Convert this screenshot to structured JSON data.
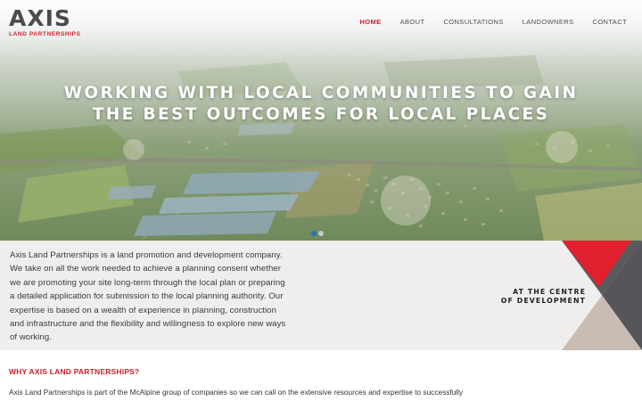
{
  "brand": {
    "name": "AXIS",
    "tagline": "LAND PARTNERSHIPS"
  },
  "nav": {
    "items": [
      {
        "label": "HOME",
        "active": true
      },
      {
        "label": "ABOUT",
        "active": false
      },
      {
        "label": "CONSULTATIONS",
        "active": false
      },
      {
        "label": "LANDOWNERS",
        "active": false
      },
      {
        "label": "CONTACT",
        "active": false
      }
    ]
  },
  "hero": {
    "line1": "WORKING WITH LOCAL COMMUNITIES TO GAIN",
    "line2": "THE BEST OUTCOMES FOR LOCAL PLACES",
    "slide_count": 2,
    "active_slide": 1
  },
  "intro": {
    "text": "Axis Land Partnerships is a land promotion and development company. We take on all the work needed to achieve a planning consent whether we are promoting your site long-term through the local plan or preparing a detailed application for submission to the local planning authority. Our expertise is based on a wealth of experience in planning, construction and infrastructure and the flexibility and willingness to explore new ways of working.",
    "tagline_line1": "AT THE CENTRE",
    "tagline_line2": "OF DEVELOPMENT"
  },
  "why": {
    "heading": "WHY AXIS LAND PARTNERSHIPS?",
    "body": "Axis Land Partnerships is part of the McAlpine group of companies so we can call on the extensive resources and expertise to successfully negotiate your projects through the planning process from the vast construction and civil engineering"
  },
  "colors": {
    "brand_red": "#d0202e",
    "brand_grey": "#4a4a4f",
    "band_bg": "#f0eeed",
    "triangle_dark": "#5a5a5e",
    "triangle_light": "#c8bcb3"
  }
}
